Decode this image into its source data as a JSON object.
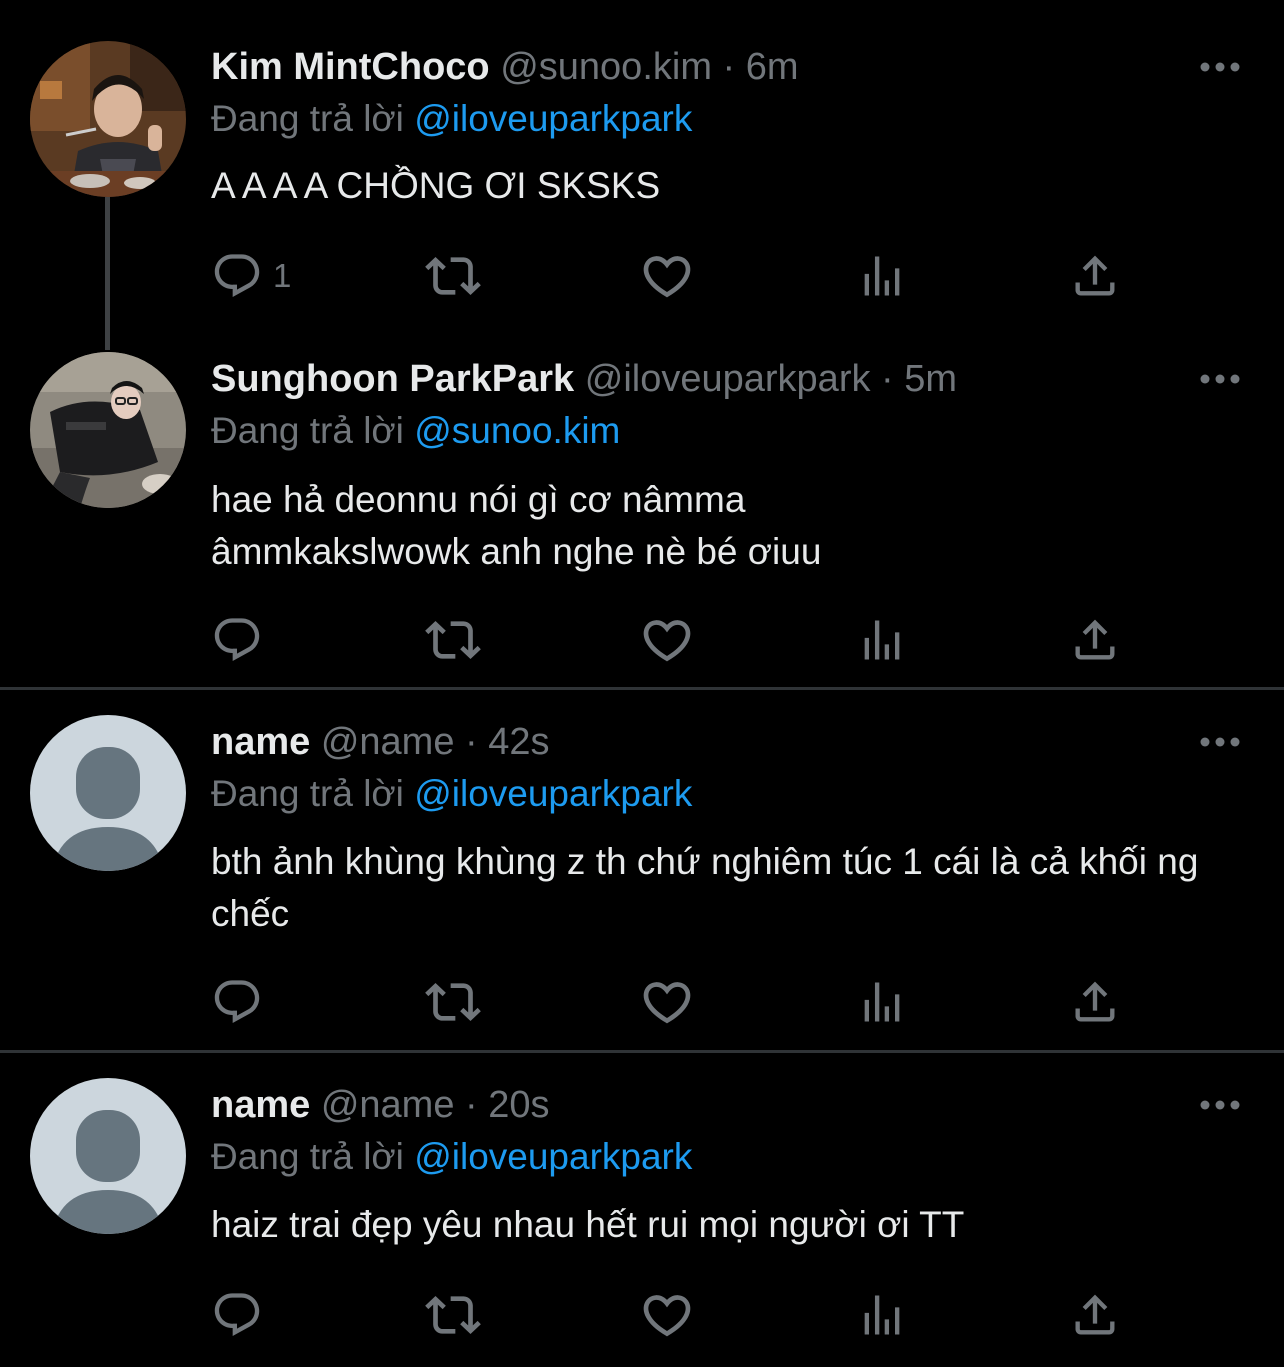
{
  "tweets": [
    {
      "display_name": "Kim MintChoco",
      "handle": "@sunoo.kim",
      "separator": "·",
      "time": "6m",
      "reply_prefix": "Đang trả lời",
      "reply_to": "@iloveuparkpark",
      "text": "A A A A CHỒNG ƠI SKSKS",
      "reply_count": "1",
      "avatar": "photo",
      "icons": [
        "reply-icon",
        "retweet-icon",
        "like-icon",
        "views-icon",
        "share-icon",
        "more-icon"
      ]
    },
    {
      "display_name": "Sunghoon ParkPark",
      "handle": "@iloveuparkpark",
      "separator": "·",
      "time": "5m",
      "reply_prefix": "Đang trả lời",
      "reply_to": "@sunoo.kim",
      "text": "hae hả deonnu nói gì cơ nâmma âmmkakslwowk anh nghe nè bé ơiuu",
      "reply_count": "",
      "avatar": "photo"
    },
    {
      "display_name": "name",
      "handle": "@name",
      "separator": "·",
      "time": "42s",
      "reply_prefix": "Đang trả lời",
      "reply_to": "@iloveuparkpark",
      "text": "bth ảnh khùng khùng z th chứ nghiêm túc 1 cái là cả khối ng chếc",
      "reply_count": "",
      "avatar": "default-avatar"
    },
    {
      "display_name": "name",
      "handle": "@name",
      "separator": "·",
      "time": "20s",
      "reply_prefix": "Đang trả lời",
      "reply_to": "@iloveuparkpark",
      "text": "haiz trai đẹp yêu nhau hết rui mọi người ơi TT",
      "reply_count": "",
      "avatar": "default-avatar"
    }
  ],
  "colors": {
    "background": "#000000",
    "text": "#e7e9ea",
    "secondary": "#71767b",
    "link": "#1d9bf0",
    "divider": "#2f3336",
    "default_avatar_bg": "#ccd6dd",
    "default_avatar_fg": "#66757f"
  }
}
